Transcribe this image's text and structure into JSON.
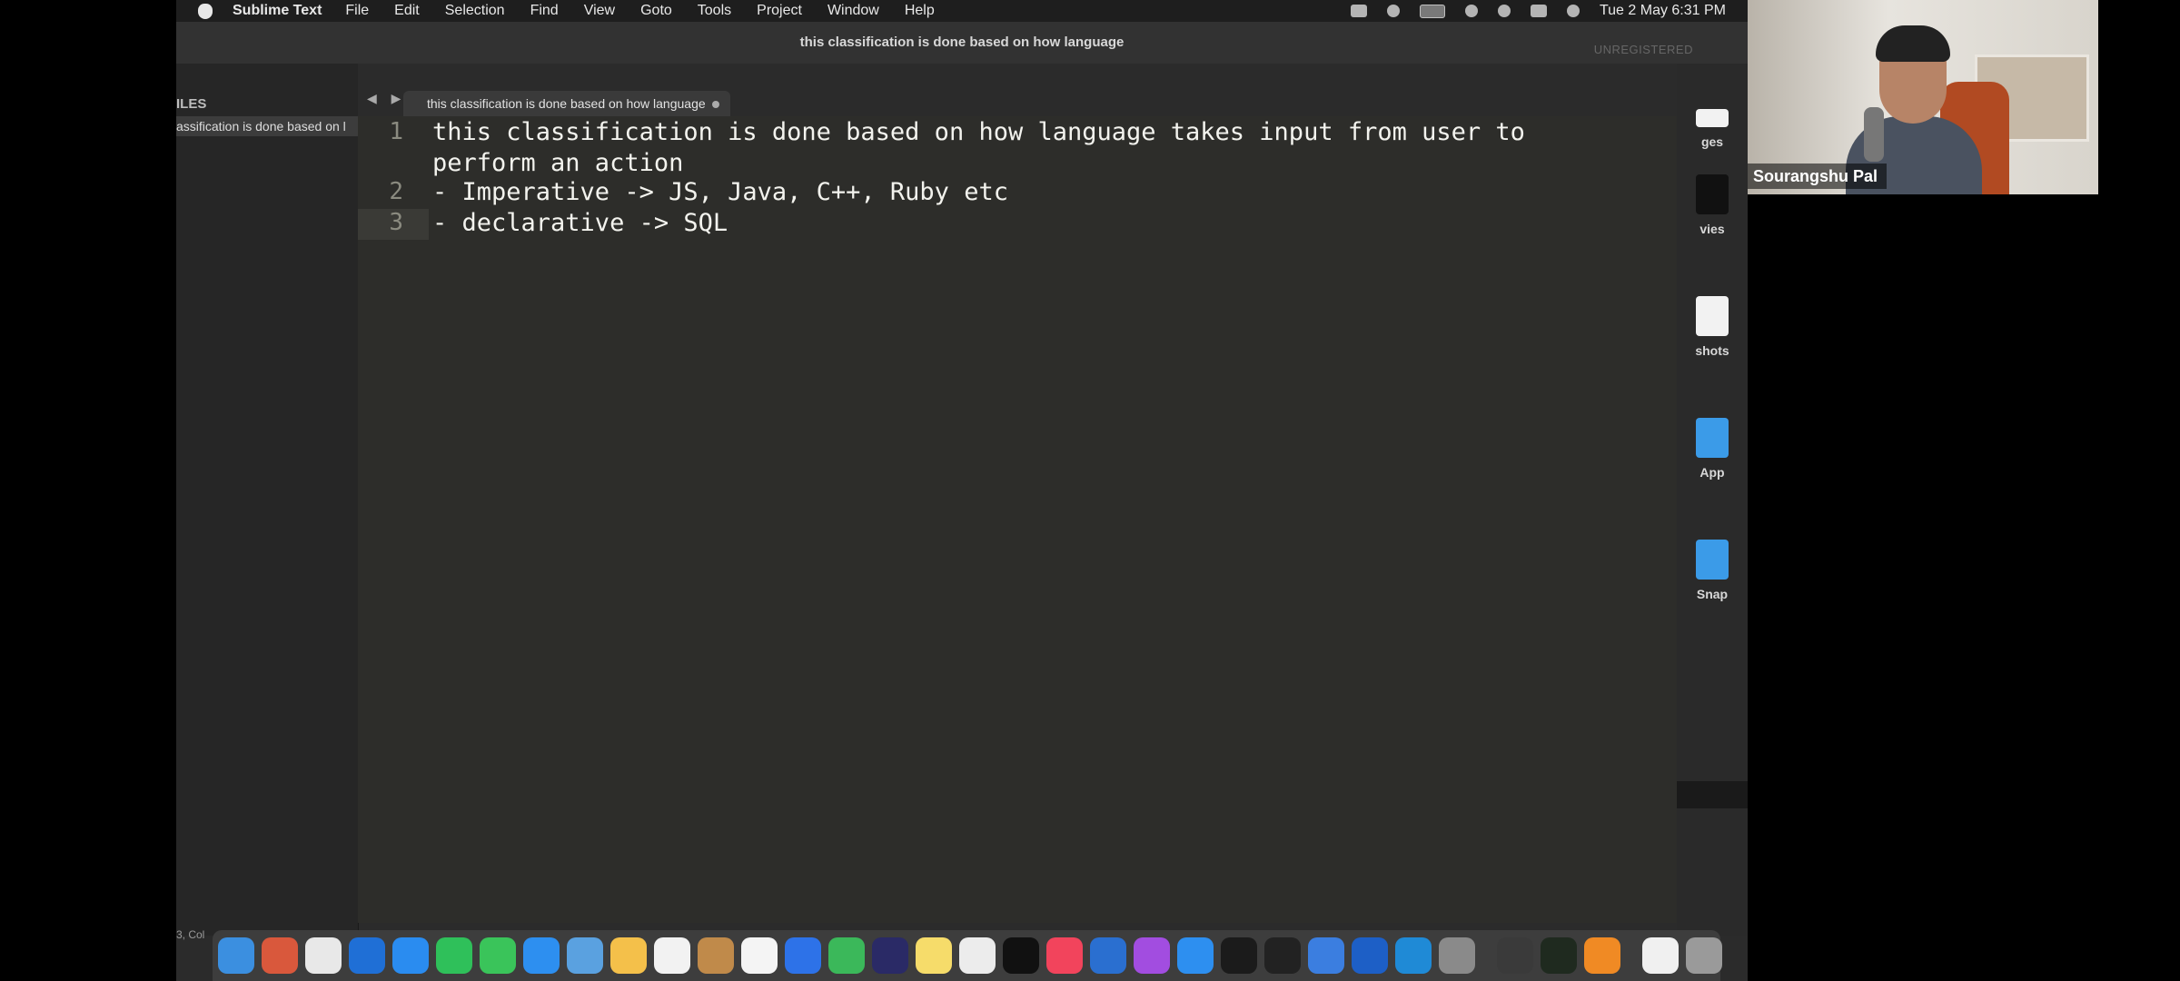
{
  "menubar": {
    "app_name": "Sublime Text",
    "menus": [
      "File",
      "Edit",
      "Selection",
      "Find",
      "View",
      "Goto",
      "Tools",
      "Project",
      "Window",
      "Help"
    ],
    "datetime": "Tue 2 May  6:31 PM"
  },
  "window": {
    "title": "this classification is done based on how language",
    "unregistered": "UNREGISTERED"
  },
  "sidebar": {
    "heading": "ILES",
    "file_item": "assification is done based on l",
    "status_text": "3, Col"
  },
  "tab": {
    "label": "this classification is done based on how language",
    "nav_arrows": "◀ ▶"
  },
  "editor": {
    "line_numbers": [
      "1",
      "2",
      "3"
    ],
    "lines": [
      "this classification is done based on how language takes input from user to",
      "perform an action",
      "- Imperative -> JS, Java, C++, Ruby etc",
      "- declarative -> SQL"
    ]
  },
  "desktop": {
    "items": [
      "ges",
      "vies",
      "shots",
      "App",
      "Snap"
    ]
  },
  "webcam": {
    "participant_name": "Sourangshu Pal"
  },
  "colors": {
    "editor_bg": "#2d2d2a",
    "folder_blue": "#3b9be8"
  }
}
